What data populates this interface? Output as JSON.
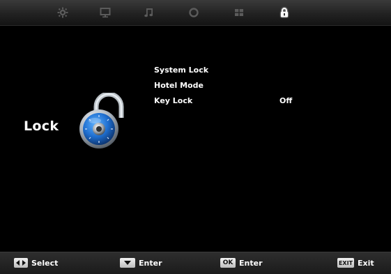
{
  "tabs": [
    {
      "icon": "gear-icon",
      "active": false
    },
    {
      "icon": "monitor-icon",
      "active": false
    },
    {
      "icon": "music-note-icon",
      "active": false
    },
    {
      "icon": "clock-icon",
      "active": false
    },
    {
      "icon": "grid-icon",
      "active": false
    },
    {
      "icon": "padlock-icon",
      "active": true
    }
  ],
  "page": {
    "title": "Lock"
  },
  "menu": {
    "items": [
      {
        "label": "System Lock",
        "value": ""
      },
      {
        "label": "Hotel Mode",
        "value": ""
      },
      {
        "label": "Key Lock",
        "value": "Off"
      }
    ]
  },
  "footer": {
    "select": {
      "label": "Select",
      "icon": "left-right-arrows-icon"
    },
    "enter_down": {
      "label": "Enter",
      "icon": "down-arrow-icon"
    },
    "ok": {
      "key": "OK",
      "label": "Enter"
    },
    "exit": {
      "key": "EXIT",
      "label": "Exit"
    }
  },
  "colors": {
    "background": "#000000",
    "active_tab": "#ffffff",
    "inactive_tab": "#5b5b5b",
    "lock_dial": "#1f6fd0"
  }
}
